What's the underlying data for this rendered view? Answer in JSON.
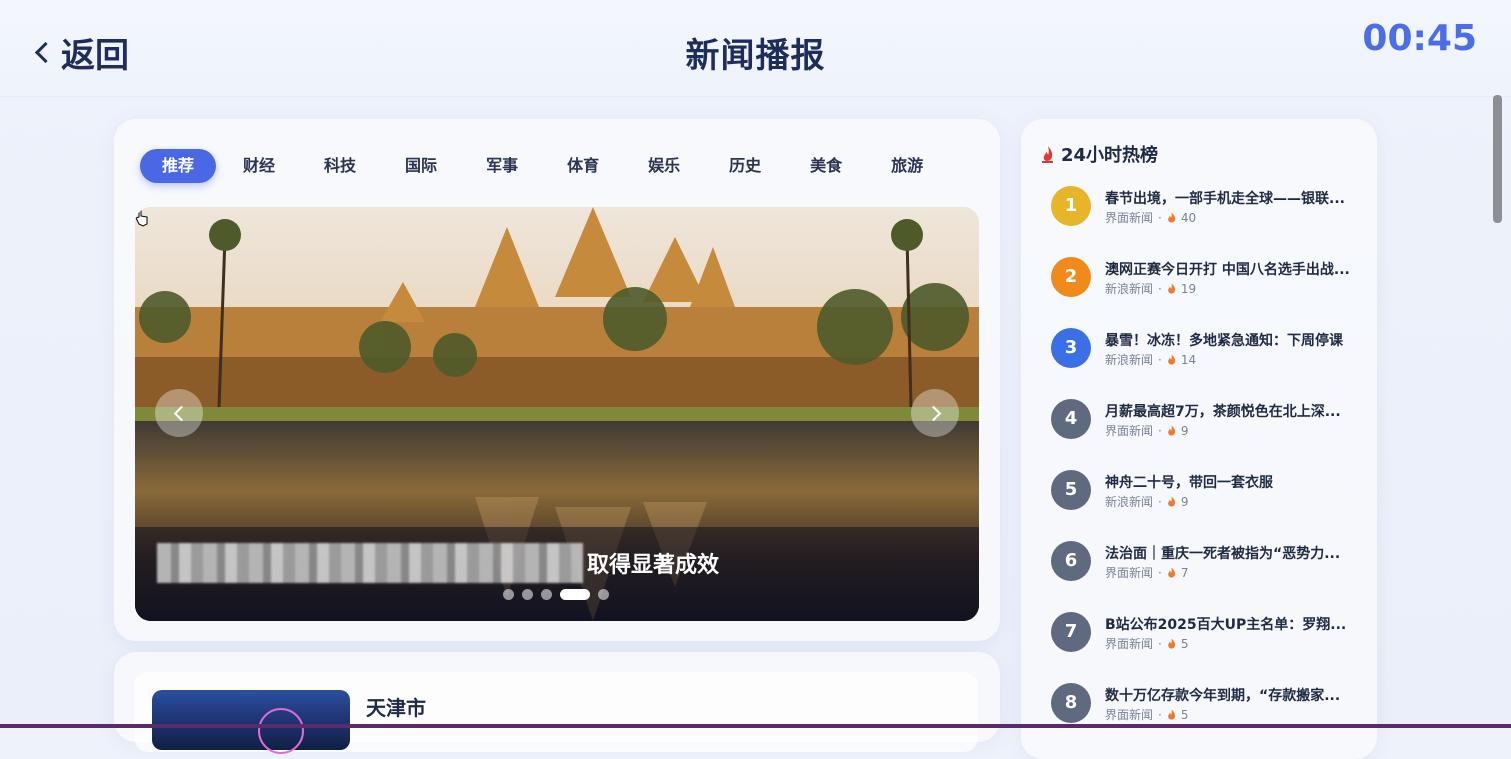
{
  "header": {
    "back_label": "返回",
    "title": "新闻播报",
    "clock": "00:45"
  },
  "tabs": [
    {
      "label": "推荐",
      "active": true
    },
    {
      "label": "财经"
    },
    {
      "label": "科技"
    },
    {
      "label": "国际"
    },
    {
      "label": "军事"
    },
    {
      "label": "体育"
    },
    {
      "label": "娱乐"
    },
    {
      "label": "历史"
    },
    {
      "label": "美食"
    },
    {
      "label": "旅游"
    }
  ],
  "carousel": {
    "caption_visible": "取得显著成效",
    "slide_count": 5,
    "active_slide": 4
  },
  "news_list": {
    "first_title": "天津市"
  },
  "hot": {
    "title": "24小时热榜",
    "items": [
      {
        "rank": "1",
        "title": "春节出境，一部手机走全球——银联...",
        "source": "界面新闻",
        "heat": "40",
        "color": "#e7b52a"
      },
      {
        "rank": "2",
        "title": "澳网正赛今日开打 中国八名选手出战...",
        "source": "新浪新闻",
        "heat": "19",
        "color": "#f08a1a"
      },
      {
        "rank": "3",
        "title": "暴雪！冰冻！多地紧急通知：下周停课",
        "source": "新浪新闻",
        "heat": "14",
        "color": "#3a6fe6"
      },
      {
        "rank": "4",
        "title": "月薪最高超7万，茶颜悦色在北上深...",
        "source": "界面新闻",
        "heat": "9",
        "color": "#5f6a80"
      },
      {
        "rank": "5",
        "title": "神舟二十号，带回一套衣服",
        "source": "新浪新闻",
        "heat": "9",
        "color": "#5f6a80"
      },
      {
        "rank": "6",
        "title": "法治面｜重庆一死者被指为“恶势力...",
        "source": "界面新闻",
        "heat": "7",
        "color": "#5f6a80"
      },
      {
        "rank": "7",
        "title": "B站公布2025百大UP主名单：罗翔...",
        "source": "界面新闻",
        "heat": "5",
        "color": "#5f6a80"
      },
      {
        "rank": "8",
        "title": "数十万亿存款今年到期，“存款搬家...",
        "source": "界面新闻",
        "heat": "5",
        "color": "#5f6a80"
      }
    ]
  },
  "meta_separator": "·"
}
